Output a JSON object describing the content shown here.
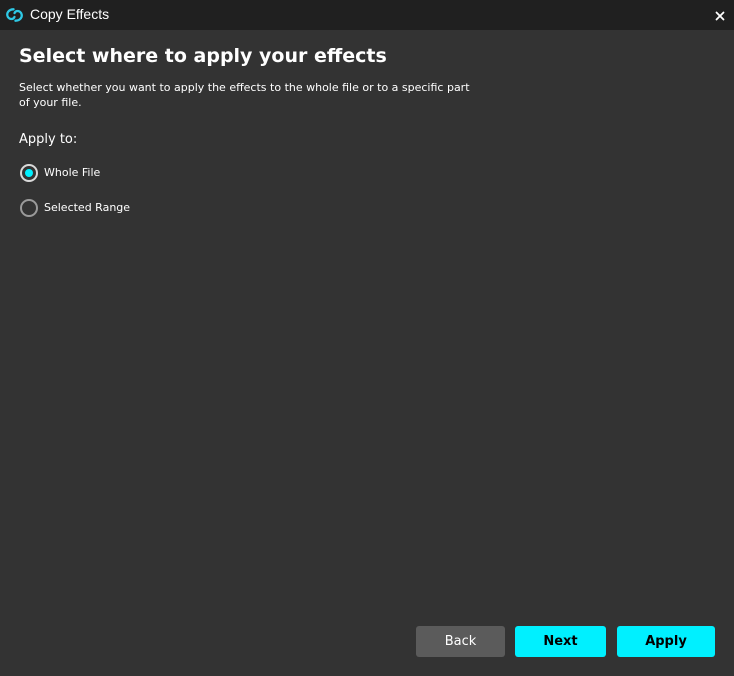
{
  "window": {
    "title": "Copy Effects",
    "app_icon": "swirl-logo-icon",
    "close_icon": "close-icon",
    "close_glyph": "×"
  },
  "main": {
    "heading": "Select where to apply your effects",
    "description": "Select whether you want to apply the effects to the whole file or to a specific part of your file.",
    "apply_to_label": "Apply to:",
    "options": [
      {
        "label": "Whole File",
        "selected": true
      },
      {
        "label": "Selected Range",
        "selected": false
      }
    ]
  },
  "footer": {
    "back_label": "Back",
    "next_label": "Next",
    "apply_label": "Apply"
  },
  "colors": {
    "accent": "#00f0ff",
    "background": "#333333",
    "titlebar": "#202020",
    "secondary_button": "#5b5b5b"
  }
}
